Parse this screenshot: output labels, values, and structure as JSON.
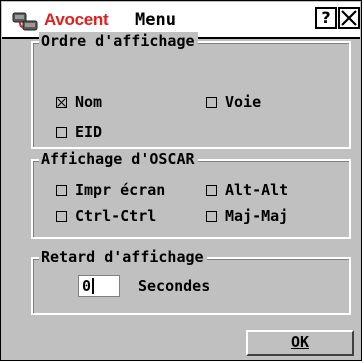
{
  "titlebar": {
    "brand": "Avocent",
    "title": "Menu",
    "help_label": "?",
    "close_label": "✕"
  },
  "display_order": {
    "legend": "Ordre d'affichage",
    "options": [
      {
        "label": "Nom",
        "checked": true
      },
      {
        "label": "Voie",
        "checked": false
      },
      {
        "label": "EID",
        "checked": false
      }
    ]
  },
  "oscar_display": {
    "legend": "Affichage d'OSCAR",
    "options": [
      {
        "label": "Impr écran",
        "checked": false
      },
      {
        "label": "Alt-Alt",
        "checked": false
      },
      {
        "label": "Ctrl-Ctrl",
        "checked": false
      },
      {
        "label": "Maj-Maj",
        "checked": false
      }
    ]
  },
  "display_delay": {
    "legend": "Retard d'affichage",
    "value": "0",
    "unit": "Secondes"
  },
  "ok_label": "OK",
  "colors": {
    "brand": "#e02020",
    "background": "#c0c0c0"
  }
}
